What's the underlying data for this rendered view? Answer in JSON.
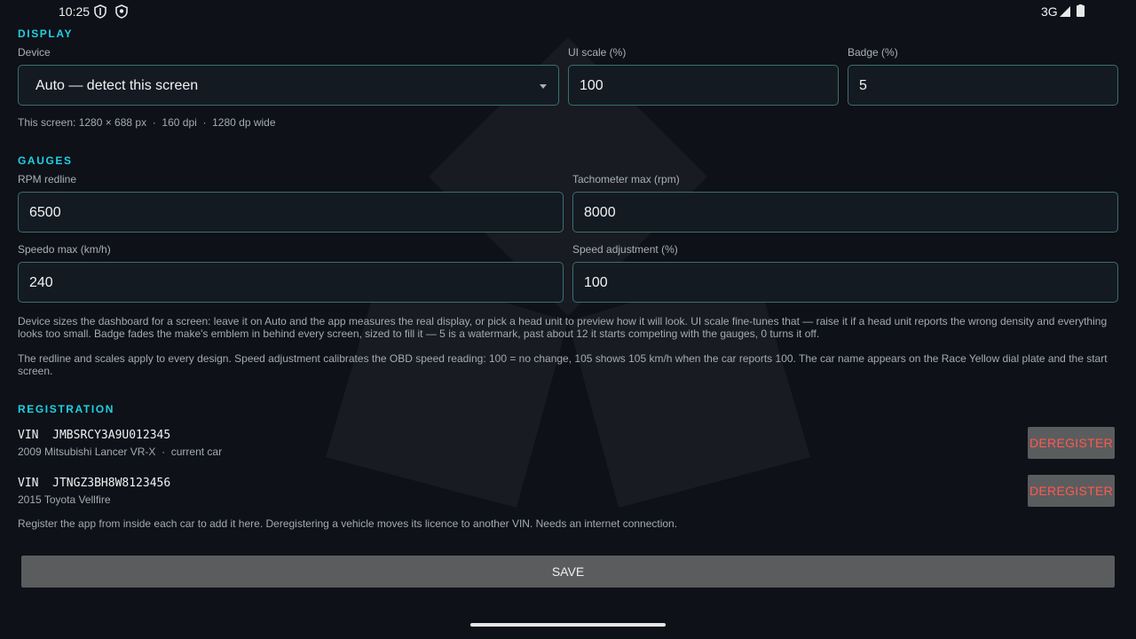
{
  "status_bar": {
    "time": "10:25",
    "network": "3G",
    "icons": [
      "shield-icon",
      "vpn-icon",
      "signal-icon",
      "battery-icon"
    ]
  },
  "display": {
    "title": "DISPLAY",
    "device_label": "Device",
    "device_value": "Auto — detect this screen",
    "ui_scale_label": "UI scale (%)",
    "ui_scale_value": "100",
    "badge_label": "Badge (%)",
    "badge_value": "5",
    "screen_info": "This screen: 1280 × 688 px  ·  160 dpi  ·  1280 dp wide"
  },
  "gauges": {
    "title": "GAUGES",
    "rpm_redline_label": "RPM redline",
    "rpm_redline_value": "6500",
    "tach_max_label": "Tachometer max (rpm)",
    "tach_max_value": "8000",
    "speedo_max_label": "Speedo max (km/h)",
    "speedo_max_value": "240",
    "speed_adj_label": "Speed adjustment (%)",
    "speed_adj_value": "100",
    "desc_1": "Device sizes the dashboard for a screen: leave it on Auto and the app measures the real display, or pick a head unit to preview how it will look. UI scale fine-tunes that — raise it if a head unit reports the wrong density and everything looks too small. Badge fades the make's emblem in behind every screen, sized to fill it — 5 is a watermark, past about 12 it starts competing with the gauges, 0 turns it off.",
    "desc_2": "The redline and scales apply to every design. Speed adjustment calibrates the OBD speed reading: 100 = no change, 105 shows 105 km/h when the car reports 100. The car name appears on the Race Yellow dial plate and the start screen."
  },
  "registration": {
    "title": "REGISTRATION",
    "vehicles": [
      {
        "vin": "VIN  JMBSRCY3A9U012345",
        "subtitle": "2009 Mitsubishi Lancer VR-X  ·  current car",
        "button": "DEREGISTER"
      },
      {
        "vin": "VIN  JTNGZ3BH8W8123456",
        "subtitle": "2015 Toyota Vellfire",
        "button": "DEREGISTER"
      }
    ],
    "note": "Register the app from inside each car to add it here. Deregistering a vehicle moves its licence to another VIN. Needs an internet connection."
  },
  "save_label": "SAVE",
  "colors": {
    "background": "#0e1117",
    "accent": "#1ed1e6",
    "field_border": "#3a6e74",
    "danger": "#ff5a4e",
    "button": "#5b5c5e"
  }
}
